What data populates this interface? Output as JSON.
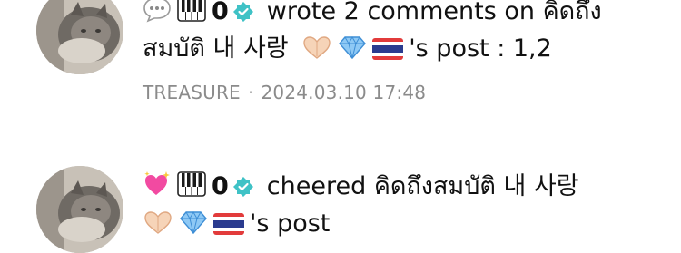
{
  "notifications": [
    {
      "type_icon": "speech-bubble-icon",
      "actor": {
        "name_prefix_icon": "piano-keys-icon",
        "name": "0",
        "verified_icon": "verified-badge-icon"
      },
      "action_text": "wrote 2 comments on คิดถึง",
      "line2_text": "สมบัติ 내 사랑",
      "decor_icons": [
        "heart-hands-icon",
        "gem-icon",
        "thailand-flag-icon"
      ],
      "post_suffix": "'s post : 1,2",
      "meta": {
        "source": "TREASURE",
        "separator": "·",
        "timestamp": "2024.03.10 17:48"
      }
    },
    {
      "type_icon": "sparkling-heart-icon",
      "actor": {
        "name_prefix_icon": "piano-keys-icon",
        "name": "0",
        "verified_icon": "verified-badge-icon"
      },
      "action_text": "cheered คิดถึงสมบัติ 내 사랑",
      "decor_icons": [
        "heart-hands-icon",
        "gem-icon",
        "thailand-flag-icon"
      ],
      "post_suffix": "'s post"
    }
  ],
  "colors": {
    "text": "#111111",
    "meta_text": "#8b8b8b",
    "verified_badge": "#3fc2c6",
    "background": "#ffffff"
  }
}
